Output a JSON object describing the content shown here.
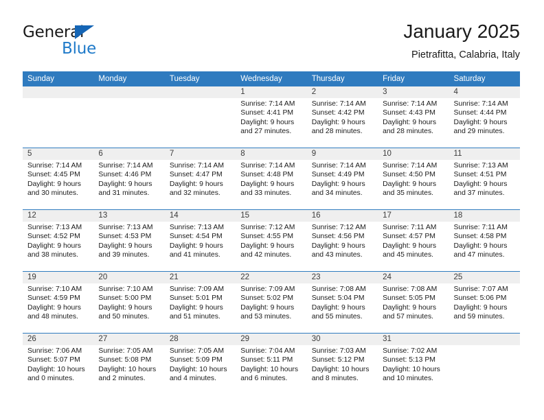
{
  "brand": {
    "name_top": "General",
    "name_bottom": "Blue",
    "triangle_color": "#1565b5",
    "blue_color": "#1f7ac9"
  },
  "header": {
    "title": "January 2025",
    "subtitle": "Pietrafitta, Calabria, Italy"
  },
  "theme": {
    "header_blue": "#2f7bbf",
    "daynum_band": "#efefef",
    "text": "#1a1a1a"
  },
  "weekdays": [
    "Sunday",
    "Monday",
    "Tuesday",
    "Wednesday",
    "Thursday",
    "Friday",
    "Saturday"
  ],
  "weeks": [
    [
      {
        "day": "",
        "sunrise": "",
        "sunset": "",
        "daylight_1": "",
        "daylight_2": ""
      },
      {
        "day": "",
        "sunrise": "",
        "sunset": "",
        "daylight_1": "",
        "daylight_2": ""
      },
      {
        "day": "",
        "sunrise": "",
        "sunset": "",
        "daylight_1": "",
        "daylight_2": ""
      },
      {
        "day": "1",
        "sunrise": "Sunrise: 7:14 AM",
        "sunset": "Sunset: 4:41 PM",
        "daylight_1": "Daylight: 9 hours",
        "daylight_2": "and 27 minutes."
      },
      {
        "day": "2",
        "sunrise": "Sunrise: 7:14 AM",
        "sunset": "Sunset: 4:42 PM",
        "daylight_1": "Daylight: 9 hours",
        "daylight_2": "and 28 minutes."
      },
      {
        "day": "3",
        "sunrise": "Sunrise: 7:14 AM",
        "sunset": "Sunset: 4:43 PM",
        "daylight_1": "Daylight: 9 hours",
        "daylight_2": "and 28 minutes."
      },
      {
        "day": "4",
        "sunrise": "Sunrise: 7:14 AM",
        "sunset": "Sunset: 4:44 PM",
        "daylight_1": "Daylight: 9 hours",
        "daylight_2": "and 29 minutes."
      }
    ],
    [
      {
        "day": "5",
        "sunrise": "Sunrise: 7:14 AM",
        "sunset": "Sunset: 4:45 PM",
        "daylight_1": "Daylight: 9 hours",
        "daylight_2": "and 30 minutes."
      },
      {
        "day": "6",
        "sunrise": "Sunrise: 7:14 AM",
        "sunset": "Sunset: 4:46 PM",
        "daylight_1": "Daylight: 9 hours",
        "daylight_2": "and 31 minutes."
      },
      {
        "day": "7",
        "sunrise": "Sunrise: 7:14 AM",
        "sunset": "Sunset: 4:47 PM",
        "daylight_1": "Daylight: 9 hours",
        "daylight_2": "and 32 minutes."
      },
      {
        "day": "8",
        "sunrise": "Sunrise: 7:14 AM",
        "sunset": "Sunset: 4:48 PM",
        "daylight_1": "Daylight: 9 hours",
        "daylight_2": "and 33 minutes."
      },
      {
        "day": "9",
        "sunrise": "Sunrise: 7:14 AM",
        "sunset": "Sunset: 4:49 PM",
        "daylight_1": "Daylight: 9 hours",
        "daylight_2": "and 34 minutes."
      },
      {
        "day": "10",
        "sunrise": "Sunrise: 7:14 AM",
        "sunset": "Sunset: 4:50 PM",
        "daylight_1": "Daylight: 9 hours",
        "daylight_2": "and 35 minutes."
      },
      {
        "day": "11",
        "sunrise": "Sunrise: 7:13 AM",
        "sunset": "Sunset: 4:51 PM",
        "daylight_1": "Daylight: 9 hours",
        "daylight_2": "and 37 minutes."
      }
    ],
    [
      {
        "day": "12",
        "sunrise": "Sunrise: 7:13 AM",
        "sunset": "Sunset: 4:52 PM",
        "daylight_1": "Daylight: 9 hours",
        "daylight_2": "and 38 minutes."
      },
      {
        "day": "13",
        "sunrise": "Sunrise: 7:13 AM",
        "sunset": "Sunset: 4:53 PM",
        "daylight_1": "Daylight: 9 hours",
        "daylight_2": "and 39 minutes."
      },
      {
        "day": "14",
        "sunrise": "Sunrise: 7:13 AM",
        "sunset": "Sunset: 4:54 PM",
        "daylight_1": "Daylight: 9 hours",
        "daylight_2": "and 41 minutes."
      },
      {
        "day": "15",
        "sunrise": "Sunrise: 7:12 AM",
        "sunset": "Sunset: 4:55 PM",
        "daylight_1": "Daylight: 9 hours",
        "daylight_2": "and 42 minutes."
      },
      {
        "day": "16",
        "sunrise": "Sunrise: 7:12 AM",
        "sunset": "Sunset: 4:56 PM",
        "daylight_1": "Daylight: 9 hours",
        "daylight_2": "and 43 minutes."
      },
      {
        "day": "17",
        "sunrise": "Sunrise: 7:11 AM",
        "sunset": "Sunset: 4:57 PM",
        "daylight_1": "Daylight: 9 hours",
        "daylight_2": "and 45 minutes."
      },
      {
        "day": "18",
        "sunrise": "Sunrise: 7:11 AM",
        "sunset": "Sunset: 4:58 PM",
        "daylight_1": "Daylight: 9 hours",
        "daylight_2": "and 47 minutes."
      }
    ],
    [
      {
        "day": "19",
        "sunrise": "Sunrise: 7:10 AM",
        "sunset": "Sunset: 4:59 PM",
        "daylight_1": "Daylight: 9 hours",
        "daylight_2": "and 48 minutes."
      },
      {
        "day": "20",
        "sunrise": "Sunrise: 7:10 AM",
        "sunset": "Sunset: 5:00 PM",
        "daylight_1": "Daylight: 9 hours",
        "daylight_2": "and 50 minutes."
      },
      {
        "day": "21",
        "sunrise": "Sunrise: 7:09 AM",
        "sunset": "Sunset: 5:01 PM",
        "daylight_1": "Daylight: 9 hours",
        "daylight_2": "and 51 minutes."
      },
      {
        "day": "22",
        "sunrise": "Sunrise: 7:09 AM",
        "sunset": "Sunset: 5:02 PM",
        "daylight_1": "Daylight: 9 hours",
        "daylight_2": "and 53 minutes."
      },
      {
        "day": "23",
        "sunrise": "Sunrise: 7:08 AM",
        "sunset": "Sunset: 5:04 PM",
        "daylight_1": "Daylight: 9 hours",
        "daylight_2": "and 55 minutes."
      },
      {
        "day": "24",
        "sunrise": "Sunrise: 7:08 AM",
        "sunset": "Sunset: 5:05 PM",
        "daylight_1": "Daylight: 9 hours",
        "daylight_2": "and 57 minutes."
      },
      {
        "day": "25",
        "sunrise": "Sunrise: 7:07 AM",
        "sunset": "Sunset: 5:06 PM",
        "daylight_1": "Daylight: 9 hours",
        "daylight_2": "and 59 minutes."
      }
    ],
    [
      {
        "day": "26",
        "sunrise": "Sunrise: 7:06 AM",
        "sunset": "Sunset: 5:07 PM",
        "daylight_1": "Daylight: 10 hours",
        "daylight_2": "and 0 minutes."
      },
      {
        "day": "27",
        "sunrise": "Sunrise: 7:05 AM",
        "sunset": "Sunset: 5:08 PM",
        "daylight_1": "Daylight: 10 hours",
        "daylight_2": "and 2 minutes."
      },
      {
        "day": "28",
        "sunrise": "Sunrise: 7:05 AM",
        "sunset": "Sunset: 5:09 PM",
        "daylight_1": "Daylight: 10 hours",
        "daylight_2": "and 4 minutes."
      },
      {
        "day": "29",
        "sunrise": "Sunrise: 7:04 AM",
        "sunset": "Sunset: 5:11 PM",
        "daylight_1": "Daylight: 10 hours",
        "daylight_2": "and 6 minutes."
      },
      {
        "day": "30",
        "sunrise": "Sunrise: 7:03 AM",
        "sunset": "Sunset: 5:12 PM",
        "daylight_1": "Daylight: 10 hours",
        "daylight_2": "and 8 minutes."
      },
      {
        "day": "31",
        "sunrise": "Sunrise: 7:02 AM",
        "sunset": "Sunset: 5:13 PM",
        "daylight_1": "Daylight: 10 hours",
        "daylight_2": "and 10 minutes."
      },
      {
        "day": "",
        "sunrise": "",
        "sunset": "",
        "daylight_1": "",
        "daylight_2": ""
      }
    ]
  ]
}
